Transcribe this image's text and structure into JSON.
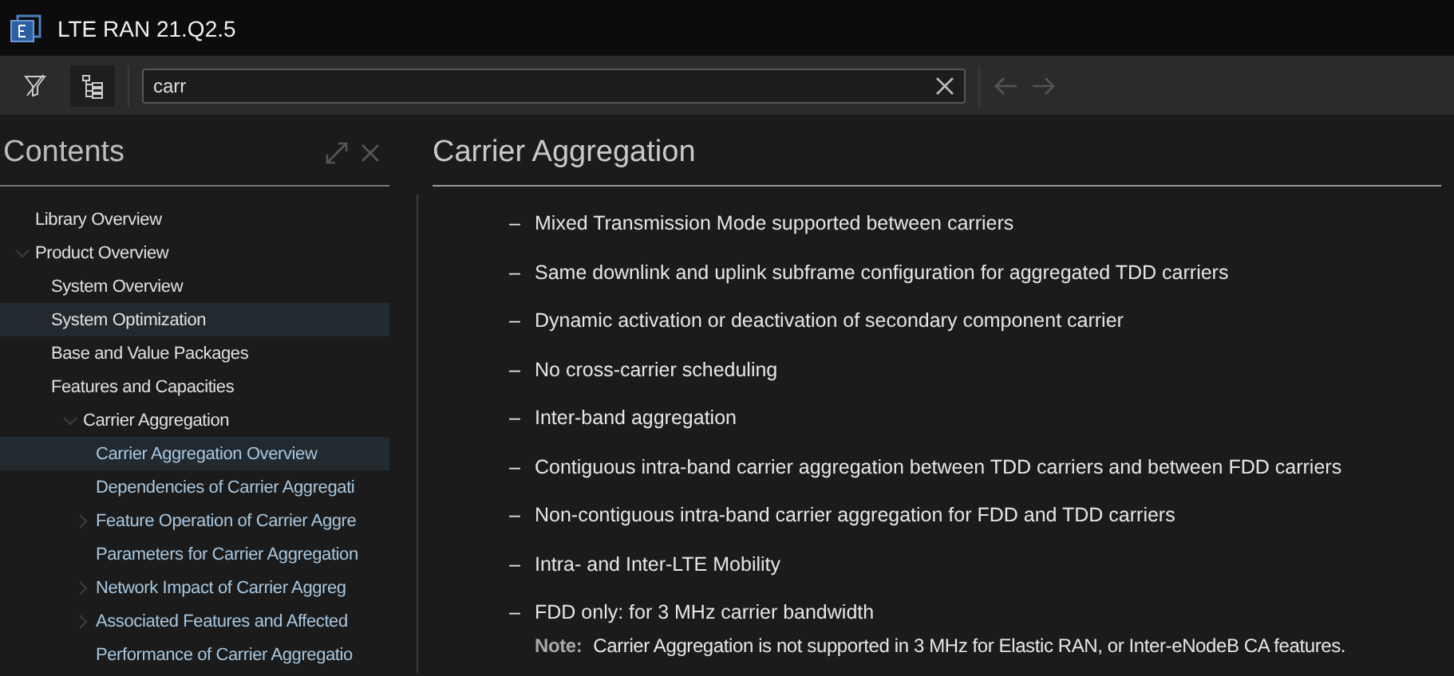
{
  "window": {
    "title": "LTE RAN 21.Q2.5"
  },
  "toolbar": {
    "search": {
      "value": "carr"
    }
  },
  "sidebar": {
    "title": "Contents",
    "tree": [
      {
        "label": "Library Overview",
        "selected": false
      },
      {
        "label": "Product Overview",
        "selected": false,
        "expanded": true,
        "children": [
          {
            "label": "System Overview",
            "selected": false
          },
          {
            "label": "System Optimization",
            "selected": true
          },
          {
            "label": "Base and Value Packages",
            "selected": false
          },
          {
            "label": "Features and Capacities",
            "selected": false,
            "children": [
              {
                "label": "Carrier Aggregation",
                "selected": false,
                "expanded": true,
                "children": [
                  {
                    "label": "Carrier Aggregation Overview",
                    "selected": true
                  },
                  {
                    "label": "Dependencies of Carrier Aggregati",
                    "selected": false
                  },
                  {
                    "label": "Feature Operation of Carrier Aggre",
                    "selected": false,
                    "expanded": false
                  },
                  {
                    "label": "Parameters for Carrier Aggregation",
                    "selected": false
                  },
                  {
                    "label": "Network Impact of Carrier Aggreg",
                    "selected": false,
                    "expanded": false
                  },
                  {
                    "label": "Associated Features and Affected",
                    "selected": false,
                    "expanded": false
                  },
                  {
                    "label": "Performance of Carrier Aggregatio",
                    "selected": false
                  }
                ]
              }
            ]
          }
        ]
      }
    ]
  },
  "article": {
    "title": "Carrier Aggregation",
    "items": [
      {
        "marker": "–",
        "text": "Mixed Transmission Mode supported between carriers"
      },
      {
        "marker": "–",
        "text": "Same downlink and uplink subframe configuration for aggregated TDD carriers"
      },
      {
        "marker": "–",
        "text": "Dynamic activation or deactivation of secondary component carrier"
      },
      {
        "marker": "–",
        "text": "No cross-carrier scheduling"
      },
      {
        "marker": "–",
        "text": "Inter-band aggregation"
      },
      {
        "marker": "–",
        "text": "Contiguous intra-band carrier aggregation between TDD carriers and between FDD carriers"
      },
      {
        "marker": "–",
        "text": "Non-contiguous intra-band carrier aggregation for FDD and TDD carriers"
      },
      {
        "marker": "–",
        "text": "Intra- and Inter-LTE Mobility"
      },
      {
        "marker": "–",
        "text": "FDD only: for 3 MHz carrier bandwidth"
      }
    ],
    "note": {
      "label": "Note:",
      "text": "Carrier Aggregation is not supported in 3 MHz for Elastic RAN, or Inter-eNodeB CA features."
    }
  }
}
